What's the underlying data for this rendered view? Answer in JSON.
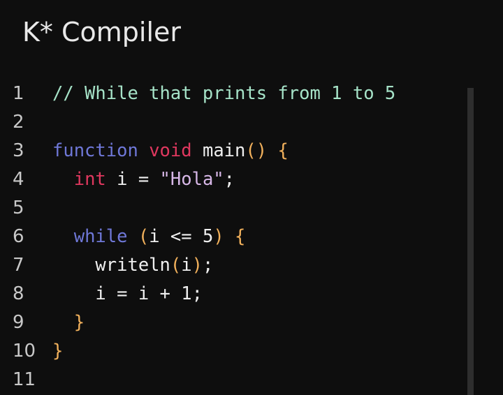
{
  "app": {
    "title": "K* Compiler"
  },
  "editor": {
    "line_numbers": [
      "1",
      "2",
      "3",
      "4",
      "5",
      "6",
      "7",
      "8",
      "9",
      "10",
      "11"
    ],
    "lines": [
      {
        "indent": "",
        "tokens": [
          {
            "text": "// While that prints from 1 to 5",
            "kind": "comment"
          }
        ]
      },
      {
        "indent": "",
        "tokens": []
      },
      {
        "indent": "",
        "tokens": [
          {
            "text": "function",
            "kind": "keyword"
          },
          {
            "text": " ",
            "kind": "plain"
          },
          {
            "text": "void",
            "kind": "type"
          },
          {
            "text": " main",
            "kind": "plain"
          },
          {
            "text": "()",
            "kind": "bracket"
          },
          {
            "text": " ",
            "kind": "plain"
          },
          {
            "text": "{",
            "kind": "bracket"
          }
        ]
      },
      {
        "indent": "  ",
        "tokens": [
          {
            "text": "int",
            "kind": "type"
          },
          {
            "text": " i = ",
            "kind": "plain"
          },
          {
            "text": "\"Hola\"",
            "kind": "string"
          },
          {
            "text": ";",
            "kind": "plain"
          }
        ]
      },
      {
        "indent": "",
        "tokens": []
      },
      {
        "indent": "  ",
        "tokens": [
          {
            "text": "while",
            "kind": "keyword"
          },
          {
            "text": " ",
            "kind": "plain"
          },
          {
            "text": "(",
            "kind": "bracket"
          },
          {
            "text": "i <= 5",
            "kind": "plain"
          },
          {
            "text": ")",
            "kind": "bracket"
          },
          {
            "text": " ",
            "kind": "plain"
          },
          {
            "text": "{",
            "kind": "bracket"
          }
        ]
      },
      {
        "indent": "    ",
        "tokens": [
          {
            "text": "writeln",
            "kind": "plain"
          },
          {
            "text": "(",
            "kind": "bracket"
          },
          {
            "text": "i",
            "kind": "plain"
          },
          {
            "text": ")",
            "kind": "bracket"
          },
          {
            "text": ";",
            "kind": "plain"
          }
        ]
      },
      {
        "indent": "    ",
        "tokens": [
          {
            "text": "i = i + 1;",
            "kind": "plain"
          }
        ]
      },
      {
        "indent": "  ",
        "tokens": [
          {
            "text": "}",
            "kind": "bracket"
          }
        ]
      },
      {
        "indent": "",
        "tokens": [
          {
            "text": "}",
            "kind": "bracket"
          }
        ]
      },
      {
        "indent": "",
        "tokens": []
      }
    ]
  },
  "colors": {
    "background": "#0e0e0e",
    "comment": "#a6e3c8",
    "keyword": "#6f78d8",
    "type": "#e0385f",
    "string": "#d7b7e7",
    "bracket": "#f2b15c",
    "plain": "#efefef"
  }
}
